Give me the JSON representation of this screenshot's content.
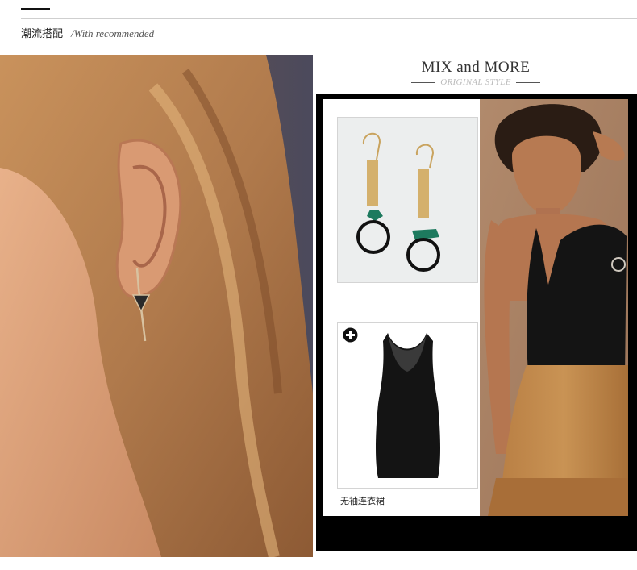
{
  "section": {
    "title_cn": "潮流搭配",
    "title_en": "/With recommended"
  },
  "mix": {
    "title": "MIX and MORE",
    "subtitle": "ORIGINAL STYLE"
  },
  "products": [
    {
      "name": "",
      "icon": "earring-product-image"
    },
    {
      "name": "无袖连衣裙",
      "icon": "dress-product-image"
    }
  ],
  "colors": {
    "panel": "#000000",
    "hair": "#b07a4c",
    "skin": "#e2a880",
    "suede": "#c08a4e"
  }
}
